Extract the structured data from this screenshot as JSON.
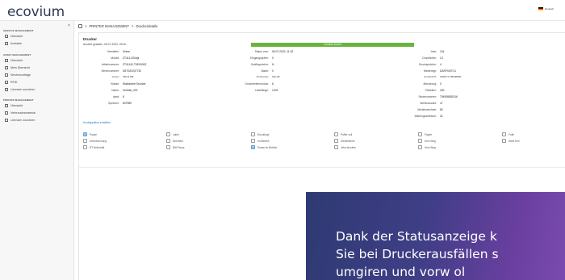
{
  "header": {
    "logo": "ecovium",
    "language": "Deutsch"
  },
  "sidebar": {
    "close": "×",
    "groups": [
      {
        "title": "SERVICE MANAGEMENT",
        "items": [
          "Übersicht",
          "Kontakte"
        ]
      },
      {
        "title": "ASSET MANAGEMENT",
        "items": [
          "Übersicht",
          "Mein Übersicht",
          "Servicevorträge",
          "RFID",
          "Lizenzen zuordnen"
        ]
      },
      {
        "title": "PRINTER MANAGEMENT",
        "items": [
          "Übersicht",
          "Verbrauchsmaterial",
          "Lizenzen zuordnen"
        ]
      }
    ]
  },
  "breadcrumb": [
    "PRINTER MANAGEMENT",
    ">",
    "Druckerdetails"
  ],
  "card": {
    "title": "Drucker",
    "subtitle": "Ansicht geladen: 06.07.2022, 09:40",
    "status": "Drucker bereit",
    "config_link": "Konfiguration erstellen",
    "col1": [
      {
        "k": "Hersteller:",
        "v": "Zebra"
      },
      {
        "k": "Modell:",
        "v": "ZT411-200dpi"
      },
      {
        "k": "Artikelnummer:",
        "v": "ZT41142-T0E0000Z"
      },
      {
        "k": "Seriennummer:",
        "v": "D5TS20037732"
      },
      {
        "k": "Version:",
        "v": "V90.21.25Z"
      },
      {
        "k": "Klasse:",
        "v": "Stationärer Drucker"
      },
      {
        "k": "Name:",
        "v": "Vertrieb_001"
      },
      {
        "k": "dpmi:",
        "v": "8"
      },
      {
        "k": "Speicher:",
        "v": "807989"
      }
    ],
    "col2": [
      {
        "k": "Status vom:",
        "v": "06.07.2022, 11:32"
      },
      {
        "k": "Eingangspuffer:",
        "v": "0"
      },
      {
        "k": "Grafikspeicher:",
        "v": "N"
      },
      {
        "k": "Batch:",
        "v": "0"
      },
      {
        "k": "Druckmodus:",
        "v": "Tear-Off"
      },
      {
        "k": "Druckbreitenmodus:",
        "v": "6"
      },
      {
        "k": "Labellänge:",
        "v": "1229"
      }
    ],
    "col3": [
      {
        "k": "Jobs:",
        "v": "104"
      },
      {
        "k": "Druckfehler:",
        "v": "13"
      },
      {
        "k": "Druckspeicher:",
        "v": "4"
      },
      {
        "k": "Medientyp:",
        "v": "DARYNS7C4"
      },
      {
        "k": "Druckkopf ID:",
        "v": "41026-T1-Y5DA45529"
      },
      {
        "k": "Abnutzung:",
        "v": "0"
      },
      {
        "k": "Etiketten:",
        "v": "230"
      },
      {
        "k": "Seriennummer:",
        "v": "794908852016"
      },
      {
        "k": "Wellenanzahl:",
        "v": "47"
      },
      {
        "k": "Medienwechsel:",
        "v": "80"
      },
      {
        "k": "Wartungszeitraum:",
        "v": "31"
      }
    ],
    "checkboxes": [
      [
        "Pause",
        "Label",
        "Druckkopf",
        "Puffer voll",
        "Papier",
        "Folie"
      ],
      [
        "Unterbrechung",
        "Überhitzt",
        "Im Betrieb",
        "Gerätefehler",
        "Kein Weg",
        "Weiß fehl"
      ],
      [
        "RT fehlerhaft",
        "Bitt Pause",
        "Pause im Betrieb",
        "Jetzt drucken",
        "Kein Weg",
        ""
      ]
    ]
  },
  "promo": {
    "line1": "Dank der Statusanzeige k",
    "line2": "Sie bei Druckerausfällen s",
    "line3": "umgiren   und   vorw   ol"
  }
}
